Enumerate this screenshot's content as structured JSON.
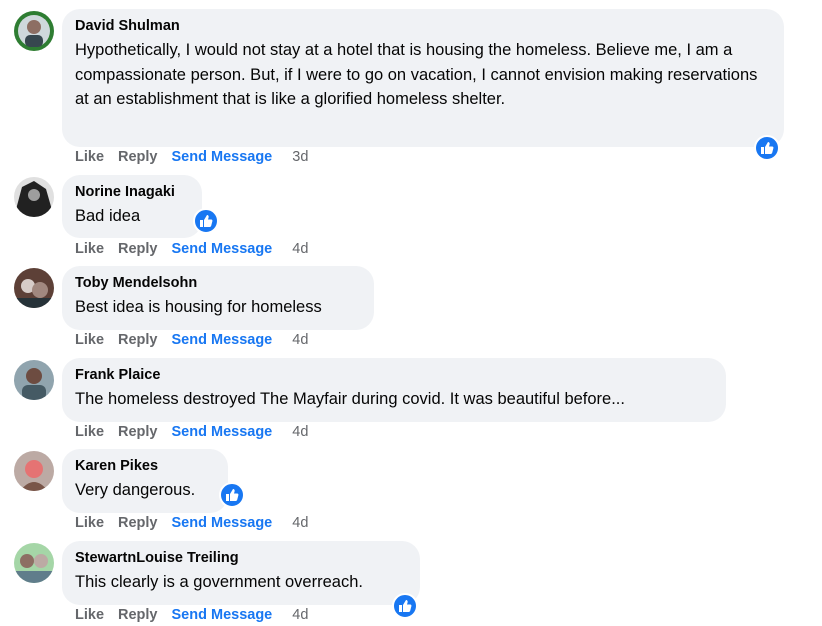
{
  "comments": [
    {
      "author": "David Shulman",
      "text": "Hypothetically, I would not stay at a hotel that is housing the homeless. Believe me, I am a compassionate person. But, if I were to go on vacation, I cannot envision making reservations at an establishment that is like a glorified homeless shelter.",
      "like": "Like",
      "reply": "Reply",
      "send": "Send Message",
      "time": "3d",
      "reaction": "thumbs-up-reaction-icon"
    },
    {
      "author": "Norine Inagaki",
      "text": "Bad idea",
      "like": "Like",
      "reply": "Reply",
      "send": "Send Message",
      "time": "4d",
      "reaction": "thumbs-up-reaction-icon"
    },
    {
      "author": "Toby Mendelsohn",
      "text": "Best idea is housing for homeless",
      "like": "Like",
      "reply": "Reply",
      "send": "Send Message",
      "time": "4d"
    },
    {
      "author": "Frank Plaice",
      "text": "The homeless destroyed The Mayfair during covid. It was beautiful before...",
      "like": "Like",
      "reply": "Reply",
      "send": "Send Message",
      "time": "4d"
    },
    {
      "author": "Karen Pikes",
      "text": "Very dangerous.",
      "like": "Like",
      "reply": "Reply",
      "send": "Send Message",
      "time": "4d",
      "reaction": "thumbs-up-reaction-icon"
    },
    {
      "author": "StewartnLouise Treiling",
      "text": "This clearly is a government overreach.",
      "like": "Like",
      "reply": "Reply",
      "send": "Send Message",
      "time": "4d",
      "reaction": "thumbs-up-reaction-icon"
    }
  ],
  "colors": {
    "link": "#1877f2",
    "muted": "#65676b",
    "bubble": "#f0f2f5",
    "reaction": "#1877f2"
  }
}
